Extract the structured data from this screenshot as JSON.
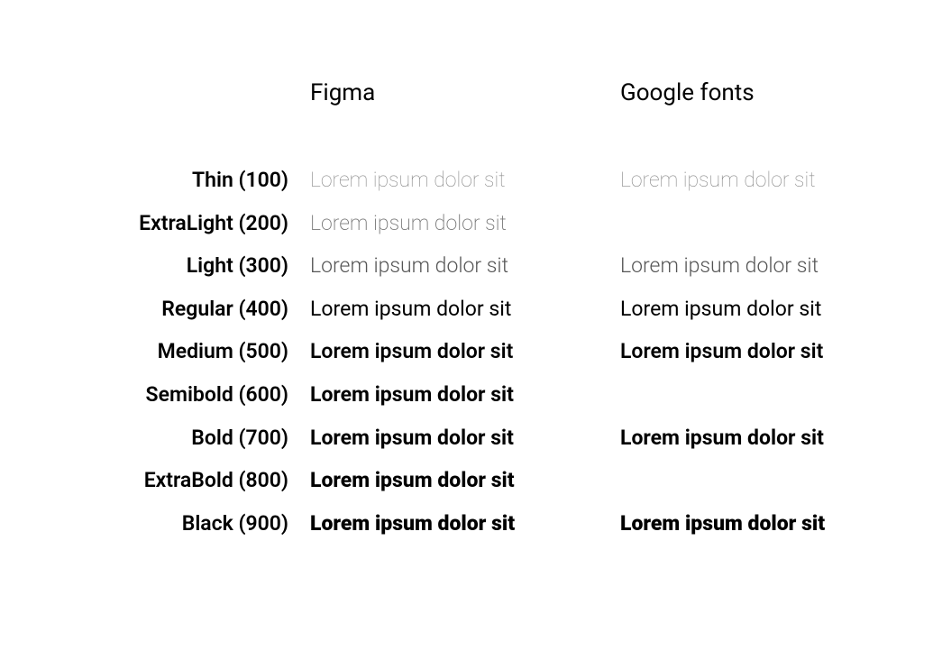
{
  "headers": {
    "col1": "Figma",
    "col2": "Google fonts"
  },
  "sample_text": "Lorem ipsum dolor sit",
  "rows": [
    {
      "label": "Thin (100)",
      "figma_class": "w100",
      "google_class": "gw100",
      "google_present": true
    },
    {
      "label": "ExtraLight (200)",
      "figma_class": "w200",
      "google_class": "",
      "google_present": false
    },
    {
      "label": "Light (300)",
      "figma_class": "w300",
      "google_class": "gw300",
      "google_present": true
    },
    {
      "label": "Regular (400)",
      "figma_class": "w400",
      "google_class": "gw400",
      "google_present": true
    },
    {
      "label": "Medium (500)",
      "figma_class": "w500",
      "google_class": "gw500",
      "google_present": true
    },
    {
      "label": "Semibold (600)",
      "figma_class": "w600",
      "google_class": "",
      "google_present": false
    },
    {
      "label": "Bold (700)",
      "figma_class": "w700",
      "google_class": "gw700",
      "google_present": true
    },
    {
      "label": "ExtraBold (800)",
      "figma_class": "w800",
      "google_class": "",
      "google_present": false
    },
    {
      "label": "Black (900)",
      "figma_class": "w900",
      "google_class": "gw900",
      "google_present": true
    }
  ]
}
